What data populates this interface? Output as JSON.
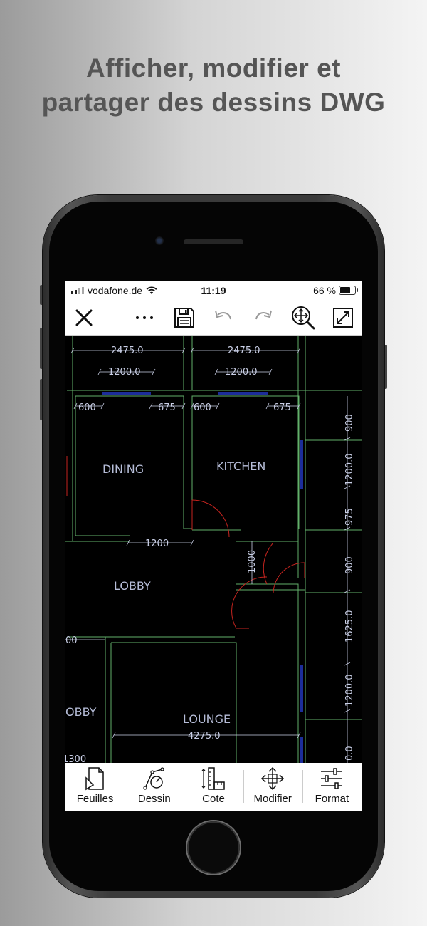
{
  "headline": {
    "line1": "Afficher, modifier et",
    "line2": "partager des dessins DWG"
  },
  "statusbar": {
    "carrier": "vodafone.de",
    "time": "11:19",
    "battery": "66 %",
    "wifi_icon": "wifi-icon"
  },
  "toolbar": {
    "close_icon": "close-icon",
    "more_icon": "more-icon",
    "save_icon": "save-icon",
    "undo_icon": "undo-icon",
    "redo_icon": "redo-icon",
    "zoom_icon": "zoom-pan-icon",
    "fullscreen_icon": "fullscreen-icon"
  },
  "drawing": {
    "rooms": [
      "DINING",
      "KITCHEN",
      "LOBBY",
      "OBBY",
      "LOUNGE"
    ],
    "dimensions": {
      "top_left_width": "2475.0",
      "top_right_width": "2475.0",
      "window_left": "1200.0",
      "window_right": "1200.0",
      "offset_600_left": "600",
      "offset_675_left": "675",
      "offset_600_right": "600",
      "offset_675_right": "675",
      "dining_bottom": "1200",
      "door_1000": "1000",
      "lounge_width": "4275.0",
      "left_00": "00",
      "left_300": "1300",
      "right_900_top": "900",
      "right_1200_top": "1200.0",
      "right_975": "975",
      "right_900_mid": "900",
      "right_1625": "1625.0",
      "right_1200_bottom": "1200.0",
      "right_0": "0.0"
    },
    "colors": {
      "wall": "#62b06a",
      "dim": "#c9cfe6",
      "window": "#1c2d9a",
      "door": "#c6241f",
      "text": "#b6bdd8"
    }
  },
  "bottombar": {
    "items": [
      {
        "label": "Feuilles",
        "icon": "sheets-icon"
      },
      {
        "label": "Dessin",
        "icon": "draw-icon"
      },
      {
        "label": "Cote",
        "icon": "dimension-icon"
      },
      {
        "label": "Modifier",
        "icon": "move-icon"
      },
      {
        "label": "Format",
        "icon": "format-sliders-icon"
      }
    ]
  }
}
